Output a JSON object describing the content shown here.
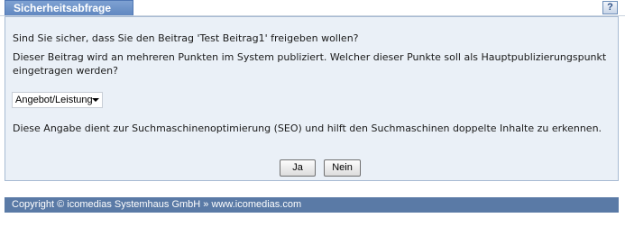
{
  "dialog": {
    "title": "Sicherheitsabfrage",
    "help_label": "?"
  },
  "content": {
    "question": "Sind Sie sicher, dass Sie den Beitrag 'Test Beitrag1' freigeben wollen?",
    "description": "Dieser Beitrag wird an mehreren Punkten im System publiziert. Welcher dieser Punkte soll als Hauptpublizierungspunkt eingetragen werden?",
    "select_value": "Angebot/Leistung",
    "seo_note": "Diese Angabe dient zur Suchmaschinenoptimierung (SEO) und hilft den Suchmaschinen doppelte Inhalte zu erkennen."
  },
  "buttons": {
    "yes_label": "Ja",
    "no_label": "Nein"
  },
  "footer": {
    "copyright": "Copyright © icomedias Systemhaus GmbH »",
    "link": "www.icomedias.com"
  },
  "colors": {
    "tab_background": "#6b8fc7",
    "panel_background": "#eaf0f7",
    "footer_background": "#5a7aa6"
  },
  "icons": {
    "select_arrow": "chevron-down-icon"
  }
}
